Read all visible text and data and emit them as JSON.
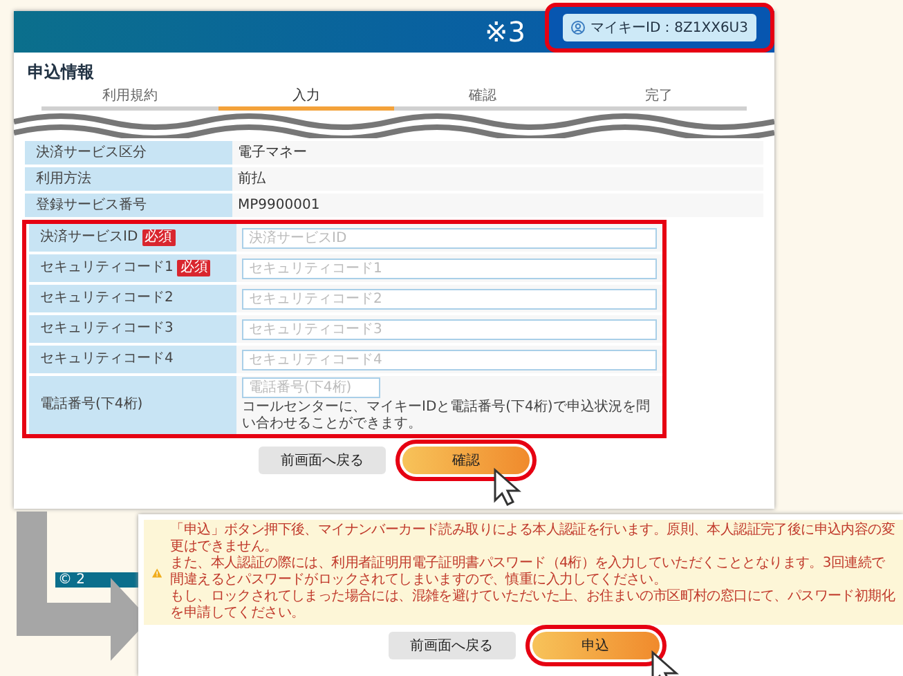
{
  "header": {
    "mark": "※3",
    "my_key_id": "マイキーID：8Z1XX6U3"
  },
  "form": {
    "title": "申込情報",
    "steps": [
      {
        "label": "利用規約",
        "selected": false
      },
      {
        "label": "入力",
        "selected": true
      },
      {
        "label": "確認",
        "selected": false
      },
      {
        "label": "完了",
        "selected": false
      }
    ],
    "rows": [
      {
        "kind": "static",
        "label": "決済サービス区分",
        "value": "電子マネー"
      },
      {
        "kind": "static",
        "label": "利用方法",
        "value": "前払"
      },
      {
        "kind": "static",
        "label": "登録サービス番号",
        "value": "MP9900001"
      },
      {
        "kind": "input",
        "label": "決済サービスID",
        "required": true,
        "required_label": "必須",
        "placeholder": "決済サービスID"
      },
      {
        "kind": "input",
        "label": "セキュリティコード1",
        "required": true,
        "required_label": "必須",
        "placeholder": "セキュリティコード1"
      },
      {
        "kind": "input",
        "label": "セキュリティコード2",
        "placeholder": "セキュリティコード2"
      },
      {
        "kind": "input",
        "label": "セキュリティコード3",
        "placeholder": "セキュリティコード3"
      },
      {
        "kind": "input",
        "label": "セキュリティコード4",
        "placeholder": "セキュリティコード4"
      },
      {
        "kind": "phone",
        "label": "電話番号(下4桁)",
        "placeholder": "電話番号(下4桁)",
        "note": "コールセンターに、マイキーIDと電話番号(下4桁)で申込状況を問い合わせることができます。"
      }
    ],
    "buttons": [
      {
        "kind": "back",
        "label": "前画面へ戻る",
        "highlighted": false
      },
      {
        "kind": "primary",
        "label": "確認",
        "highlighted": true
      }
    ]
  },
  "footer": "© 2",
  "confirm_panel": {
    "warning": [
      "「申込」ボタン押下後、マイナンバーカード読み取りによる本人認証を行います。原則、本人認証完了後に申込内容の変更はできません。",
      "また、本人認証の際には、利用者証明用電子証明書パスワード（4桁）を入力していただくこととなります。3回連続で間違えるとパスワードがロックされてしまいますので、慎重に入力してください。",
      "もし、ロックされてしまった場合には、混雑を避けていただいた上、お住まいの市区町村の窓口にて、パスワード初期化を申請してください。"
    ],
    "buttons": [
      {
        "kind": "back",
        "label": "前画面へ戻る",
        "highlighted": false
      },
      {
        "kind": "primary",
        "label": "申込",
        "highlighted": true
      }
    ]
  }
}
